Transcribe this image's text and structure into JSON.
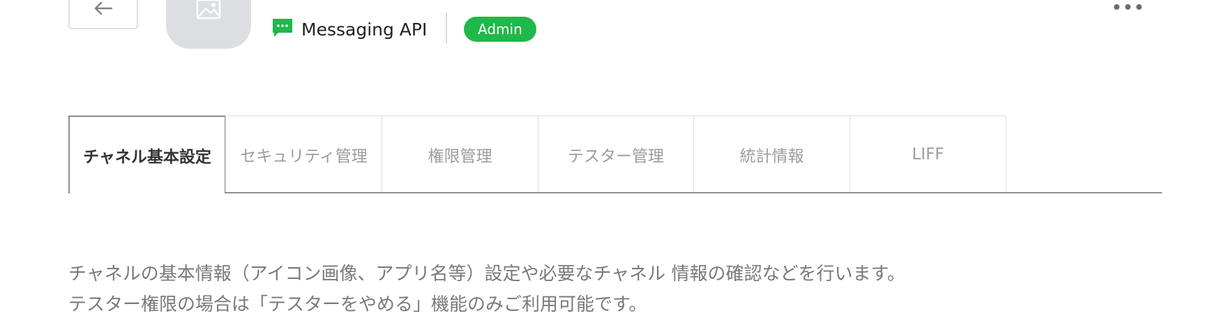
{
  "header": {
    "api_type": "Messaging API",
    "role_badge": "Admin",
    "role_badge_color": "#1fb84a",
    "api_icon_color": "#1fb84a"
  },
  "tabs": [
    {
      "label": "チャネル基本設定",
      "active": true
    },
    {
      "label": "セキュリティ管理",
      "active": false
    },
    {
      "label": "権限管理",
      "active": false
    },
    {
      "label": "テスター管理",
      "active": false
    },
    {
      "label": "統計情報",
      "active": false
    },
    {
      "label": "LIFF",
      "active": false
    }
  ],
  "description": {
    "line1": "チャネルの基本情報（アイコン画像、アプリ名等）設定や必要なチャネル 情報の確認などを行います。",
    "line2": "テスター権限の場合は「テスターをやめる」機能のみご利用可能です。"
  },
  "icons": {
    "back": "arrow-left-icon",
    "channel": "image-placeholder-icon",
    "api": "chat-bubble-icon",
    "more": "more-horizontal-icon"
  }
}
